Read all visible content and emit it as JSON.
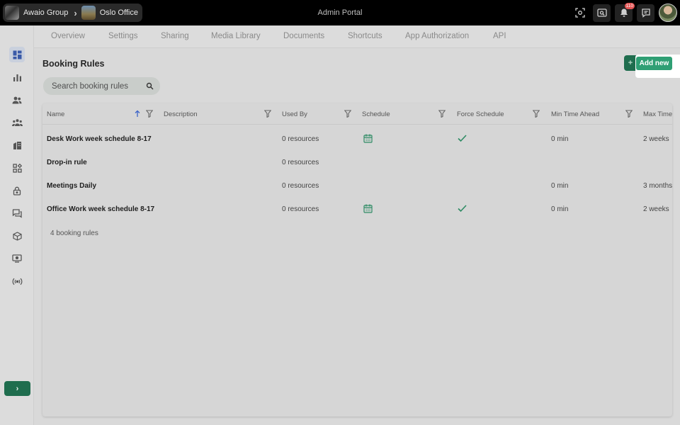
{
  "topbar": {
    "breadcrumb": [
      "Awaio Group",
      "Oslo Office"
    ],
    "title": "Admin Portal",
    "notifications_count": "110",
    "icons": [
      "scan-icon",
      "search-window-icon",
      "bell-icon",
      "chat-icon",
      "user-avatar"
    ]
  },
  "sidebar": {
    "items": [
      "dashboard-icon",
      "chart-icon",
      "users-icon",
      "team-icon",
      "building-icon",
      "apps-icon",
      "lock-icon",
      "messages-icon",
      "cube-icon",
      "display-icon",
      "signal-icon"
    ],
    "expand_label": "›"
  },
  "tabs": [
    "Overview",
    "Settings",
    "Sharing",
    "Media Library",
    "Documents",
    "Shortcuts",
    "App Authorization",
    "API"
  ],
  "main": {
    "title": "Booking Rules",
    "add_button": "Add new",
    "add_button_icon": "+",
    "search_placeholder": "Search booking rules",
    "columns": [
      "Name",
      "Description",
      "Used By",
      "Schedule",
      "Force Schedule",
      "Min Time Ahead",
      "Max Time"
    ],
    "rows": [
      {
        "name": "Desk Work week schedule 8-17",
        "description": "",
        "used_by": "0 resources",
        "schedule": true,
        "force": true,
        "min_ahead": "0 min",
        "max_time": "2 weeks"
      },
      {
        "name": "Drop-in rule",
        "description": "",
        "used_by": "0 resources",
        "schedule": false,
        "force": false,
        "min_ahead": "",
        "max_time": ""
      },
      {
        "name": "Meetings Daily",
        "description": "",
        "used_by": "0 resources",
        "schedule": false,
        "force": false,
        "min_ahead": "0 min",
        "max_time": "3 months"
      },
      {
        "name": "Office Work week schedule 8-17",
        "description": "",
        "used_by": "0 resources",
        "schedule": true,
        "force": true,
        "min_ahead": "0 min",
        "max_time": "2 weeks"
      }
    ],
    "count_label": "4 booking rules"
  },
  "colors": {
    "accent": "#1f6d4e",
    "accent_highlight": "#2f9f74",
    "check": "#2e8b64",
    "badge": "#e35353",
    "sort_arrow": "#3b63c8"
  }
}
